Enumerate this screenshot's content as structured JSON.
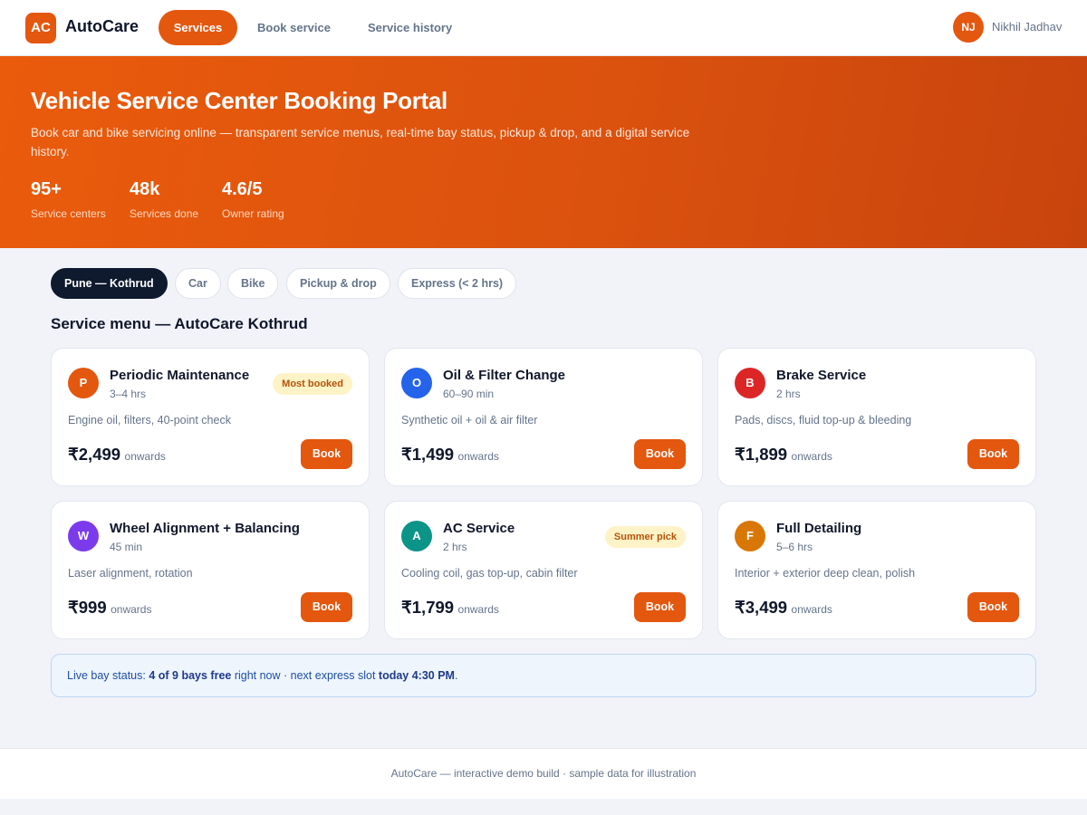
{
  "nav": {
    "logo": "AC",
    "brand": "AutoCare",
    "tabs": [
      {
        "label": "Services",
        "active": true
      },
      {
        "label": "Book service",
        "active": false
      },
      {
        "label": "Service history",
        "active": false
      }
    ],
    "user": {
      "initials": "NJ",
      "name": "Nikhil Jadhav"
    }
  },
  "hero": {
    "title": "Vehicle Service Center Booking Portal",
    "subtitle": "Book car and bike servicing online — transparent service menus, real-time bay status, pickup & drop, and a digital service history.",
    "stats": [
      {
        "value": "95+",
        "label": "Service centers"
      },
      {
        "value": "48k",
        "label": "Services done"
      },
      {
        "value": "4.6/5",
        "label": "Owner rating"
      }
    ]
  },
  "filters": [
    {
      "label": "Pune — Kothrud",
      "active": true
    },
    {
      "label": "Car",
      "active": false
    },
    {
      "label": "Bike",
      "active": false
    },
    {
      "label": "Pickup & drop",
      "active": false
    },
    {
      "label": "Express (< 2 hrs)",
      "active": false
    }
  ],
  "menu": {
    "title": "Service menu — AutoCare Kothrud",
    "book_label": "Book",
    "price_suffix": "onwards",
    "services": [
      {
        "letter": "P",
        "color": "#e4570f",
        "title": "Periodic Maintenance",
        "duration": "3–4 hrs",
        "badge": "Most booked",
        "desc": "Engine oil, filters, 40-point check",
        "price": "₹2,499"
      },
      {
        "letter": "O",
        "color": "#2563eb",
        "title": "Oil & Filter Change",
        "duration": "60–90 min",
        "badge": "",
        "desc": "Synthetic oil + oil & air filter",
        "price": "₹1,499"
      },
      {
        "letter": "B",
        "color": "#dc2626",
        "title": "Brake Service",
        "duration": "2 hrs",
        "badge": "",
        "desc": "Pads, discs, fluid top-up & bleeding",
        "price": "₹1,899"
      },
      {
        "letter": "W",
        "color": "#7c3aed",
        "title": "Wheel Alignment + Balancing",
        "duration": "45 min",
        "badge": "",
        "desc": "Laser alignment, rotation",
        "price": "₹999"
      },
      {
        "letter": "A",
        "color": "#0d9488",
        "title": "AC Service",
        "duration": "2 hrs",
        "badge": "Summer pick",
        "desc": "Cooling coil, gas top-up, cabin filter",
        "price": "₹1,799"
      },
      {
        "letter": "F",
        "color": "#d97706",
        "title": "Full Detailing",
        "duration": "5–6 hrs",
        "badge": "",
        "desc": "Interior + exterior deep clean, polish",
        "price": "₹3,499"
      }
    ]
  },
  "status": {
    "prefix": "Live bay status: ",
    "bays": "4 of 9 bays free",
    "middle": " right now · next express slot ",
    "slot": "today 4:30 PM",
    "suffix": "."
  },
  "footer": {
    "text": "AutoCare — interactive demo build · sample data for illustration"
  }
}
